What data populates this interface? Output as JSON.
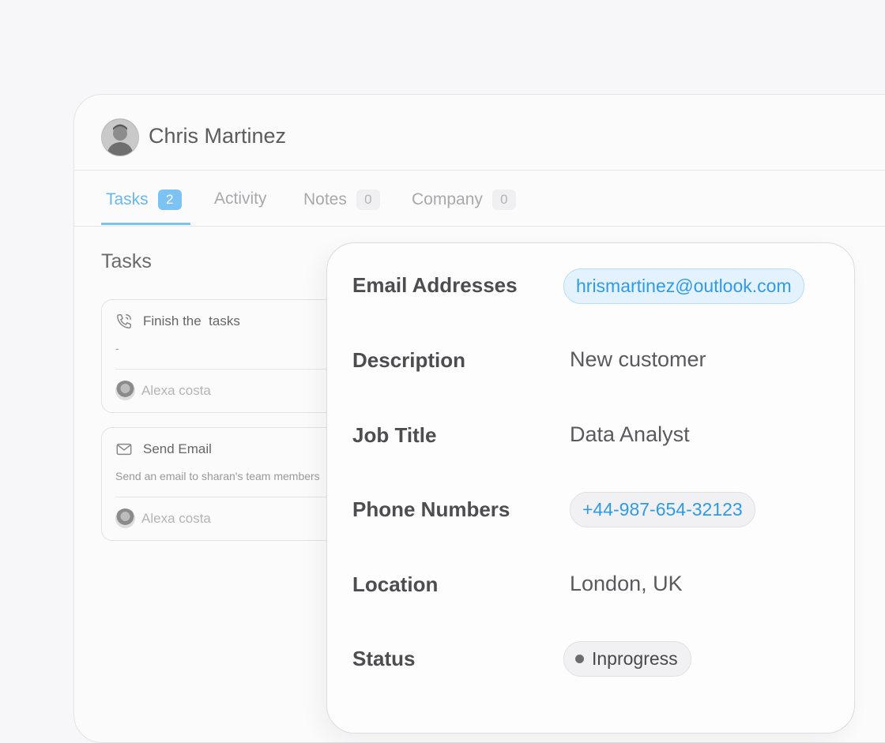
{
  "contact": {
    "name": "Chris Martinez",
    "avatar_icon": "person-photo"
  },
  "tabs": [
    {
      "label": "Tasks",
      "count": "2",
      "active": true
    },
    {
      "label": "Activity",
      "count": null,
      "active": false
    },
    {
      "label": "Notes",
      "count": "0",
      "active": false
    },
    {
      "label": "Company",
      "count": "0",
      "active": false
    }
  ],
  "tasks_section": {
    "title": "Tasks",
    "items": [
      {
        "icon": "phone-icon",
        "title": "Finish the  tasks",
        "description": "-",
        "assignee": "Alexa costa"
      },
      {
        "icon": "mail-icon",
        "title": "Send Email",
        "description": "Send an email to sharan's team members",
        "assignee": "Alexa costa"
      }
    ]
  },
  "details": {
    "email_label": "Email Addresses",
    "email_value": "hrismartinez@outlook.com",
    "description_label": "Description",
    "description_value": "New customer",
    "job_title_label": "Job Title",
    "job_title_value": "Data Analyst",
    "phone_label": "Phone Numbers",
    "phone_value": "+44-987-654-32123",
    "location_label": "Location",
    "location_value": "London, UK",
    "status_label": "Status",
    "status_value": "Inprogress"
  },
  "colors": {
    "accent": "#7cc2f2",
    "link": "#2f9be8",
    "background": "#f7f7f9"
  }
}
